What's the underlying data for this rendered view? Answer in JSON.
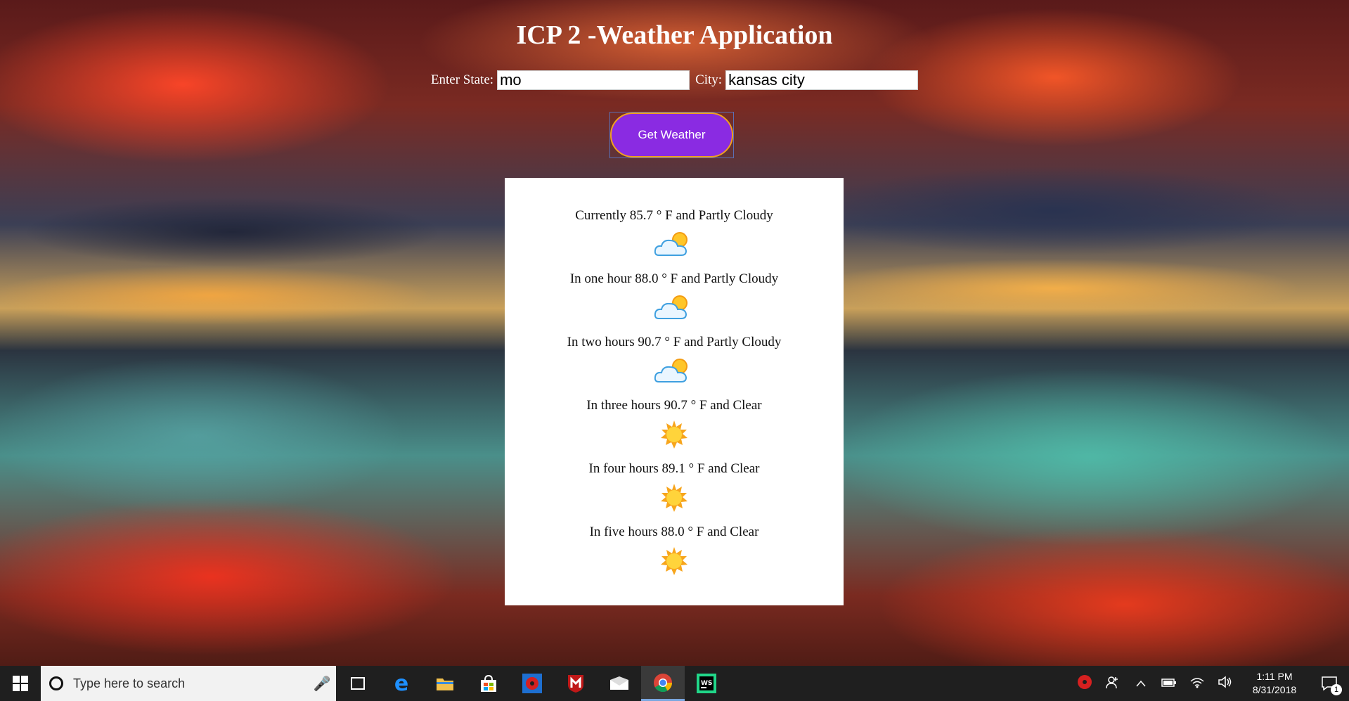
{
  "page": {
    "title": "ICP 2 -Weather Application"
  },
  "form": {
    "state_label": "Enter State:",
    "state_value": "mo",
    "city_label": "City:",
    "city_value": "kansas city",
    "button_label": "Get Weather"
  },
  "forecasts": [
    {
      "text": "Currently 85.7 ° F and Partly Cloudy",
      "icon": "partly-cloudy-icon"
    },
    {
      "text": "In one hour 88.0 ° F and Partly Cloudy",
      "icon": "partly-cloudy-icon"
    },
    {
      "text": "In two hours 90.7 ° F and Partly Cloudy",
      "icon": "partly-cloudy-icon"
    },
    {
      "text": "In three hours 90.7 ° F and Clear",
      "icon": "sun-icon"
    },
    {
      "text": "In four hours 89.1 ° F and Clear",
      "icon": "sun-icon"
    },
    {
      "text": "In five hours 88.0 ° F and Clear",
      "icon": "sun-icon"
    }
  ],
  "taskbar": {
    "search_placeholder": "Type here to search",
    "apps": [
      "task-view-icon",
      "edge-icon",
      "file-explorer-icon",
      "store-icon",
      "app-red-icon",
      "mcafee-icon",
      "mail-icon",
      "chrome-icon",
      "webstorm-icon"
    ],
    "active_app": "chrome-icon",
    "time": "1:11 PM",
    "date": "8/31/2018",
    "notification_count": "1"
  }
}
